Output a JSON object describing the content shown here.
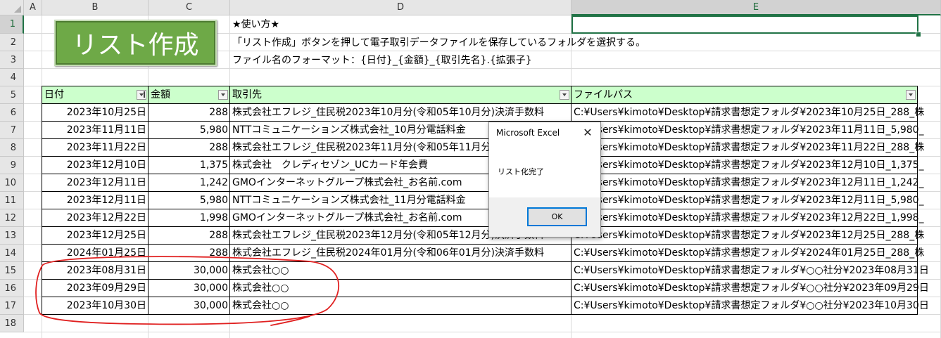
{
  "columns": [
    "A",
    "B",
    "C",
    "D",
    "E"
  ],
  "rows": [
    "1",
    "2",
    "3",
    "4",
    "5",
    "6",
    "7",
    "8",
    "9",
    "10",
    "11",
    "12",
    "13",
    "14",
    "15",
    "16",
    "17",
    "18"
  ],
  "macro_button": {
    "label": "リスト作成"
  },
  "instructions": {
    "title": "★使い方★",
    "line1": "「リスト作成」ボタンを押して電子取引データファイルを保存しているフォルダを選択する。",
    "line2": "ファイル名のフォーマット：{日付}_{金額}_{取引先名}.{拡張子}"
  },
  "table": {
    "headers": [
      "日付",
      "金額",
      "取引先",
      "ファイルパス"
    ],
    "rows": [
      [
        "2023年10月25日",
        "288",
        "株式会社エフレジ_住民税2023年10月分(令和05年10月分)決済手数料",
        "C:¥Users¥kimoto¥Desktop¥請求書想定フォルダ¥2023年10月25日_288_株"
      ],
      [
        "2023年11月11日",
        "5,980",
        "NTTコミュニケーションズ株式会社_10月分電話料金",
        "C:¥Users¥kimoto¥Desktop¥請求書想定フォルダ¥2023年11月11日_5,980_"
      ],
      [
        "2023年11月22日",
        "288",
        "株式会社エフレジ_住民税2023年11月分(令和05年11月分)決済手数料",
        "C:¥Users¥kimoto¥Desktop¥請求書想定フォルダ¥2023年11月22日_288_株"
      ],
      [
        "2023年12月10日",
        "1,375",
        "株式会社　クレディセゾン_UCカード年会費",
        "C:¥Users¥kimoto¥Desktop¥請求書想定フォルダ¥2023年12月10日_1,375_"
      ],
      [
        "2023年12月11日",
        "1,242",
        "GMOインターネットグループ株式会社_お名前.com",
        "C:¥Users¥kimoto¥Desktop¥請求書想定フォルダ¥2023年12月11日_1,242_"
      ],
      [
        "2023年12月11日",
        "5,980",
        "NTTコミュニケーションズ株式会社_11月分電話料金",
        "C:¥Users¥kimoto¥Desktop¥請求書想定フォルダ¥2023年12月11日_5,980_"
      ],
      [
        "2023年12月22日",
        "1,998",
        "GMOインターネットグループ株式会社_お名前.com",
        "C:¥Users¥kimoto¥Desktop¥請求書想定フォルダ¥2023年12月22日_1,998_"
      ],
      [
        "2023年12月25日",
        "288",
        "株式会社エフレジ_住民税2023年12月分(令和05年12月分)決済手数料",
        "C:¥Users¥kimoto¥Desktop¥請求書想定フォルダ¥2023年12月25日_288_株"
      ],
      [
        "2024年01月25日",
        "288",
        "株式会社エフレジ_住民税2024年01月分(令和06年01月分)決済手数料",
        "C:¥Users¥kimoto¥Desktop¥請求書想定フォルダ¥2024年01月25日_288_株"
      ],
      [
        "2023年08月31日",
        "30,000",
        "株式会社○○",
        "C:¥Users¥kimoto¥Desktop¥請求書想定フォルダ¥○○社分¥2023年08月31日"
      ],
      [
        "2023年09月29日",
        "30,000",
        "株式会社○○",
        "C:¥Users¥kimoto¥Desktop¥請求書想定フォルダ¥○○社分¥2023年09月29日"
      ],
      [
        "2023年10月30日",
        "30,000",
        "株式会社○○",
        "C:¥Users¥kimoto¥Desktop¥請求書想定フォルダ¥○○社分¥2023年10月30日"
      ]
    ]
  },
  "dialog": {
    "title": "Microsoft Excel",
    "message": "リスト化完了",
    "ok_label": "OK"
  },
  "colors": {
    "header_fill": "#ccffcc",
    "button_fill": "#6ea947",
    "selection": "#217346",
    "annotation": "#e02020"
  }
}
